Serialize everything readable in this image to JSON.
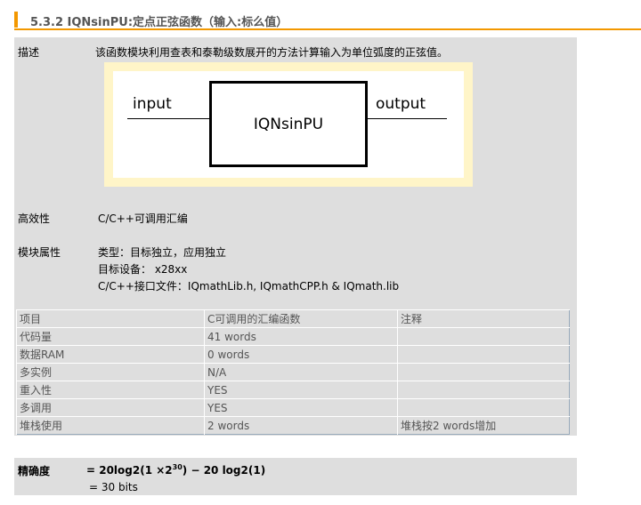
{
  "title": "5.3.2 IQNsinPU:定点正弦函数（输入:标么值）",
  "description": {
    "label": "描述",
    "text": "该函数模块利用查表和泰勒级数展开的方法计算输入为单位弧度的正弦值。"
  },
  "diagram": {
    "input": "input",
    "block": "IQNsinPU",
    "output": "output"
  },
  "efficiency": {
    "label": "高效性",
    "value": "C/C++可调用汇编"
  },
  "attributes": {
    "label": "模块属性",
    "lines": [
      "类型：目标独立，应用独立",
      "目标设备： x28xx",
      "C/C++接口文件：IQmathLib.h, IQmathCPP.h & IQmath.lib"
    ]
  },
  "table": {
    "headers": [
      "项目",
      "C可调用的汇编函数",
      "注释"
    ],
    "rows": [
      [
        "代码量",
        "41 words",
        ""
      ],
      [
        "数据RAM",
        "0 words",
        ""
      ],
      [
        "多实例",
        "N/A",
        ""
      ],
      [
        "重入性",
        "YES",
        ""
      ],
      [
        "多调用",
        "YES",
        ""
      ],
      [
        "堆栈使用",
        "2 words",
        "堆栈按2 words增加"
      ]
    ]
  },
  "accuracy": {
    "label": "精确度",
    "formula_a": "= 20log2(1 ×2",
    "formula_exp": "30",
    "formula_b": ") − 20 log2(1)",
    "result": "= 30 bits"
  }
}
